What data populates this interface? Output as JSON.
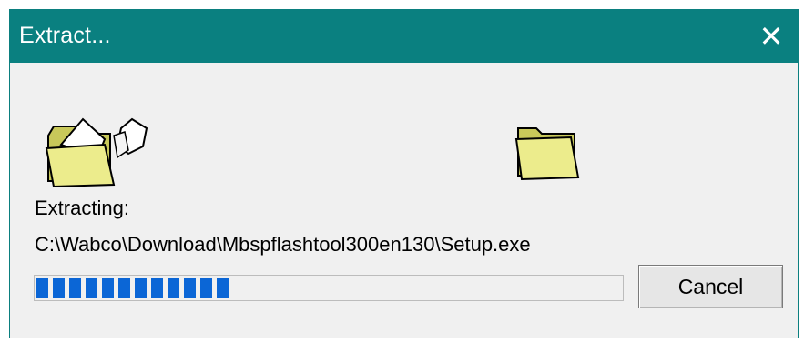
{
  "window": {
    "title": "Extract...",
    "close_symbol": "✕"
  },
  "icons": {
    "source": "folder-open-with-files-icon",
    "destination": "folder-icon"
  },
  "status": {
    "label": "Extracting:",
    "path": "C:\\Wabco\\Download\\Mbspflashtool300en130\\Setup.exe"
  },
  "progress": {
    "percent": 34,
    "color": "#0b66d6"
  },
  "buttons": {
    "cancel": "Cancel"
  },
  "colors": {
    "titlebar": "#0a8080",
    "window_bg": "#f0f0f0",
    "folder_yellow": "#ecec8c"
  }
}
